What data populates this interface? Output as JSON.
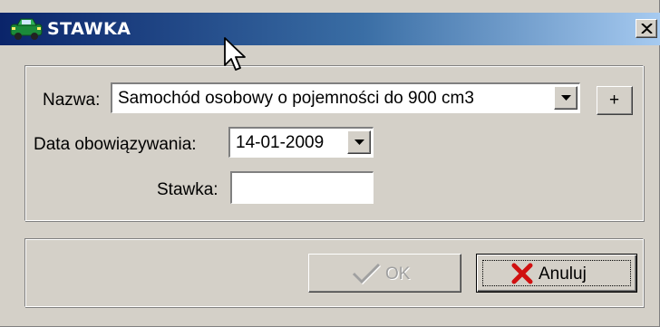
{
  "window": {
    "title": "STAWKA",
    "icon": "car-icon",
    "close_icon": "close-icon"
  },
  "form": {
    "nazwa_label": "Nazwa:",
    "nazwa_value": "Samochód osobowy o pojemności do 900 cm3",
    "add_button_label": "+",
    "date_label": "Data obowiązywania:",
    "date_value": "14-01-2009",
    "stawka_label": "Stawka:",
    "stawka_value": ""
  },
  "buttons": {
    "ok_label": "OK",
    "ok_icon": "checkmark-icon",
    "ok_enabled": false,
    "cancel_label": "Anuluj",
    "cancel_icon": "red-x-icon"
  },
  "colors": {
    "titlebar_start": "#0a246a",
    "titlebar_end": "#a6caf0",
    "face": "#d4d0c8"
  }
}
